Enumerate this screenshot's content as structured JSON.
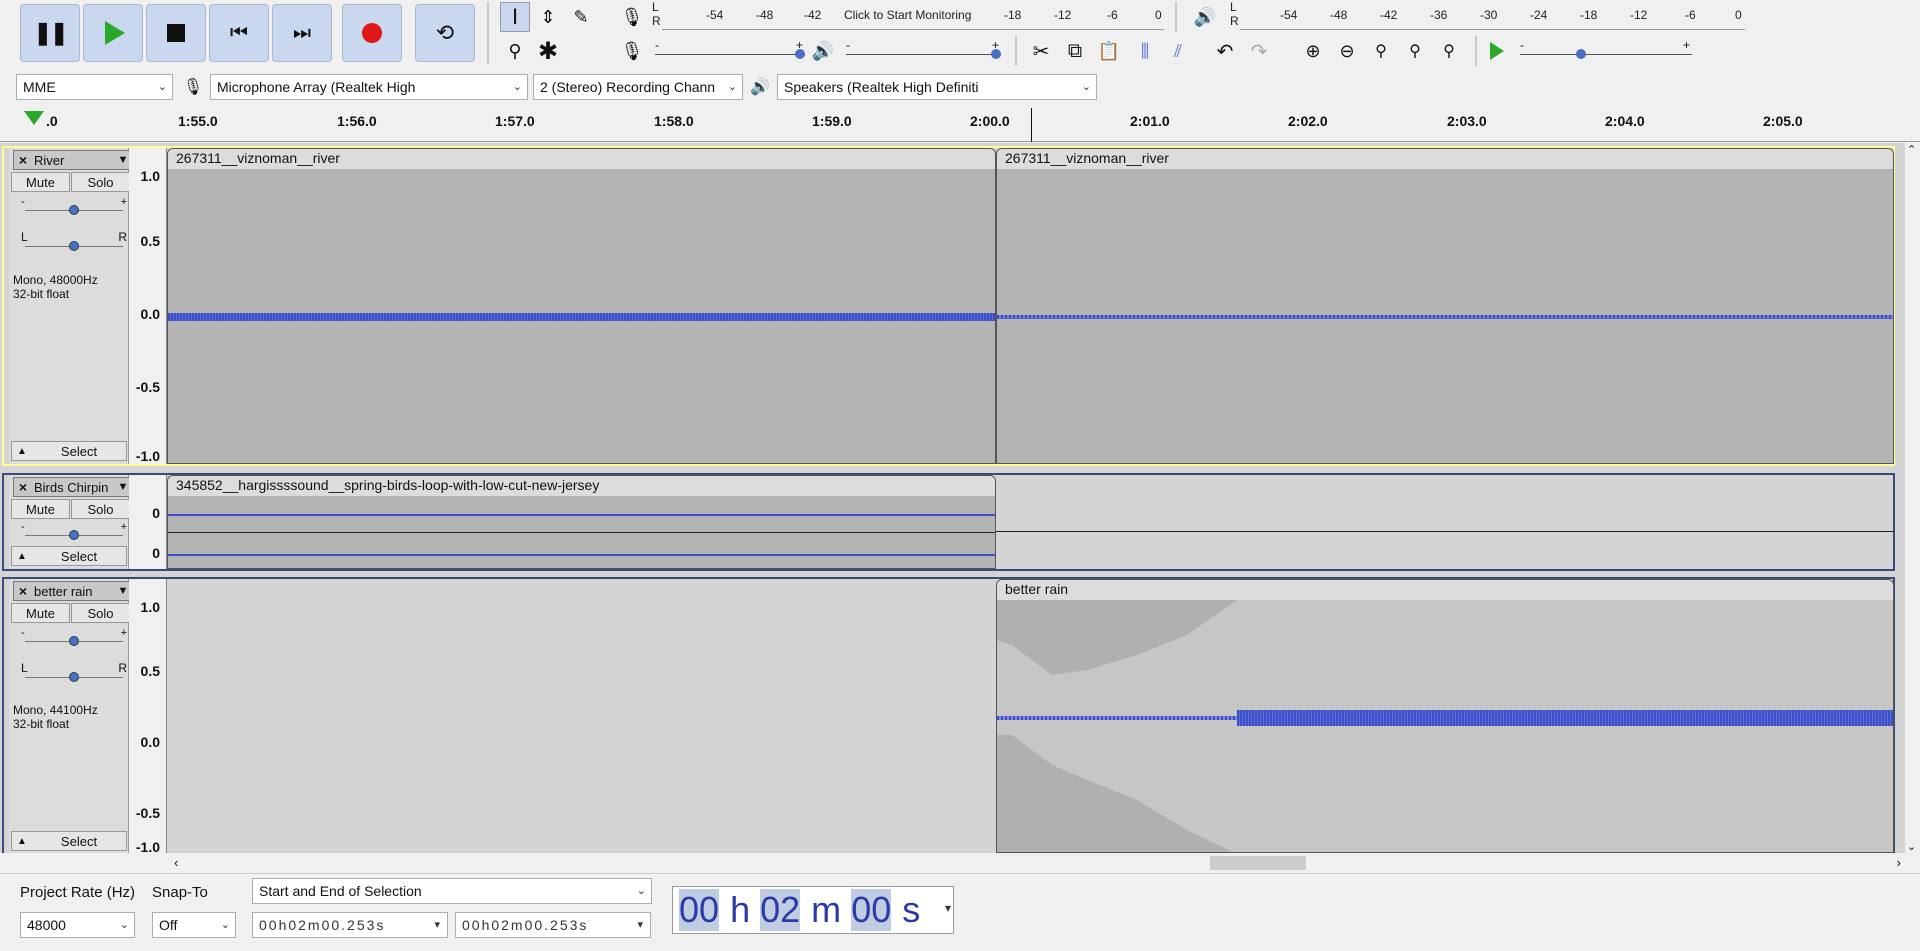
{
  "transport": {
    "pause": "pause-icon",
    "play": "play-icon",
    "stop": "stop-icon",
    "skip_start": "skip-to-start-icon",
    "skip_end": "skip-to-end-icon",
    "record": "record-icon",
    "loop": "loop-icon"
  },
  "meters": {
    "rec_lr": [
      "L",
      "R"
    ],
    "rec_ticks": [
      "-54",
      "-48",
      "-42",
      "-18",
      "-12",
      "-6",
      "0"
    ],
    "monitor_text": "Click to Start Monitoring",
    "play_lr": [
      "L",
      "R"
    ],
    "play_ticks": [
      "-54",
      "-48",
      "-42",
      "-36",
      "-30",
      "-24",
      "-18",
      "-12",
      "-6",
      "0"
    ],
    "slider_minus": "-",
    "slider_plus": "+"
  },
  "device": {
    "host": "MME",
    "input": "Microphone Array (Realtek High",
    "channels": "2 (Stereo) Recording Chann",
    "output": "Speakers (Realtek High Definiti"
  },
  "timeline": {
    "ticks": [
      "1:55.0",
      "1:56.0",
      "1:57.0",
      "1:58.0",
      "1:59.0",
      "2:00.0",
      "2:01.0",
      "2:02.0",
      "2:03.0",
      "2:04.0",
      "2:05.0"
    ],
    "first_partial": ".0"
  },
  "tracks": [
    {
      "name": "River",
      "mute": "Mute",
      "solo": "Solo",
      "gain_min": "-",
      "gain_max": "+",
      "pan_l": "L",
      "pan_r": "R",
      "info1": "Mono, 48000Hz",
      "info2": "32-bit float",
      "select": "Select",
      "scale": [
        "1.0",
        "0.5",
        "0.0",
        "-0.5",
        "-1.0"
      ],
      "clips": [
        "267311__viznoman__river",
        "267311__viznoman__river"
      ]
    },
    {
      "name": "Birds Chirpin",
      "mute": "Mute",
      "solo": "Solo",
      "gain_min": "-",
      "gain_max": "+",
      "select": "Select",
      "scale": [
        "0",
        "0"
      ],
      "clips": [
        "345852__hargissssound__spring-birds-loop-with-low-cut-new-jersey"
      ]
    },
    {
      "name": "better rain",
      "mute": "Mute",
      "solo": "Solo",
      "gain_min": "-",
      "gain_max": "+",
      "pan_l": "L",
      "pan_r": "R",
      "info1": "Mono, 44100Hz",
      "info2": "32-bit float",
      "select": "Select",
      "scale": [
        "1.0",
        "0.5",
        "0.0",
        "-0.5",
        "-1.0"
      ],
      "clips": [
        "better rain"
      ]
    }
  ],
  "bottom": {
    "rate_label": "Project Rate (Hz)",
    "rate_value": "48000",
    "snap_label": "Snap-To",
    "snap_value": "Off",
    "selection_mode": "Start and End of Selection",
    "sel_start": "00h02m00.253s",
    "sel_end": "00h02m00.253s",
    "time_big": [
      "00",
      "h",
      "02",
      "m",
      "00",
      "s"
    ]
  },
  "colors": {
    "accent": "#3b4fc8",
    "selected_track": "#ffff99",
    "toolbar_button": "#c9d8ef"
  }
}
